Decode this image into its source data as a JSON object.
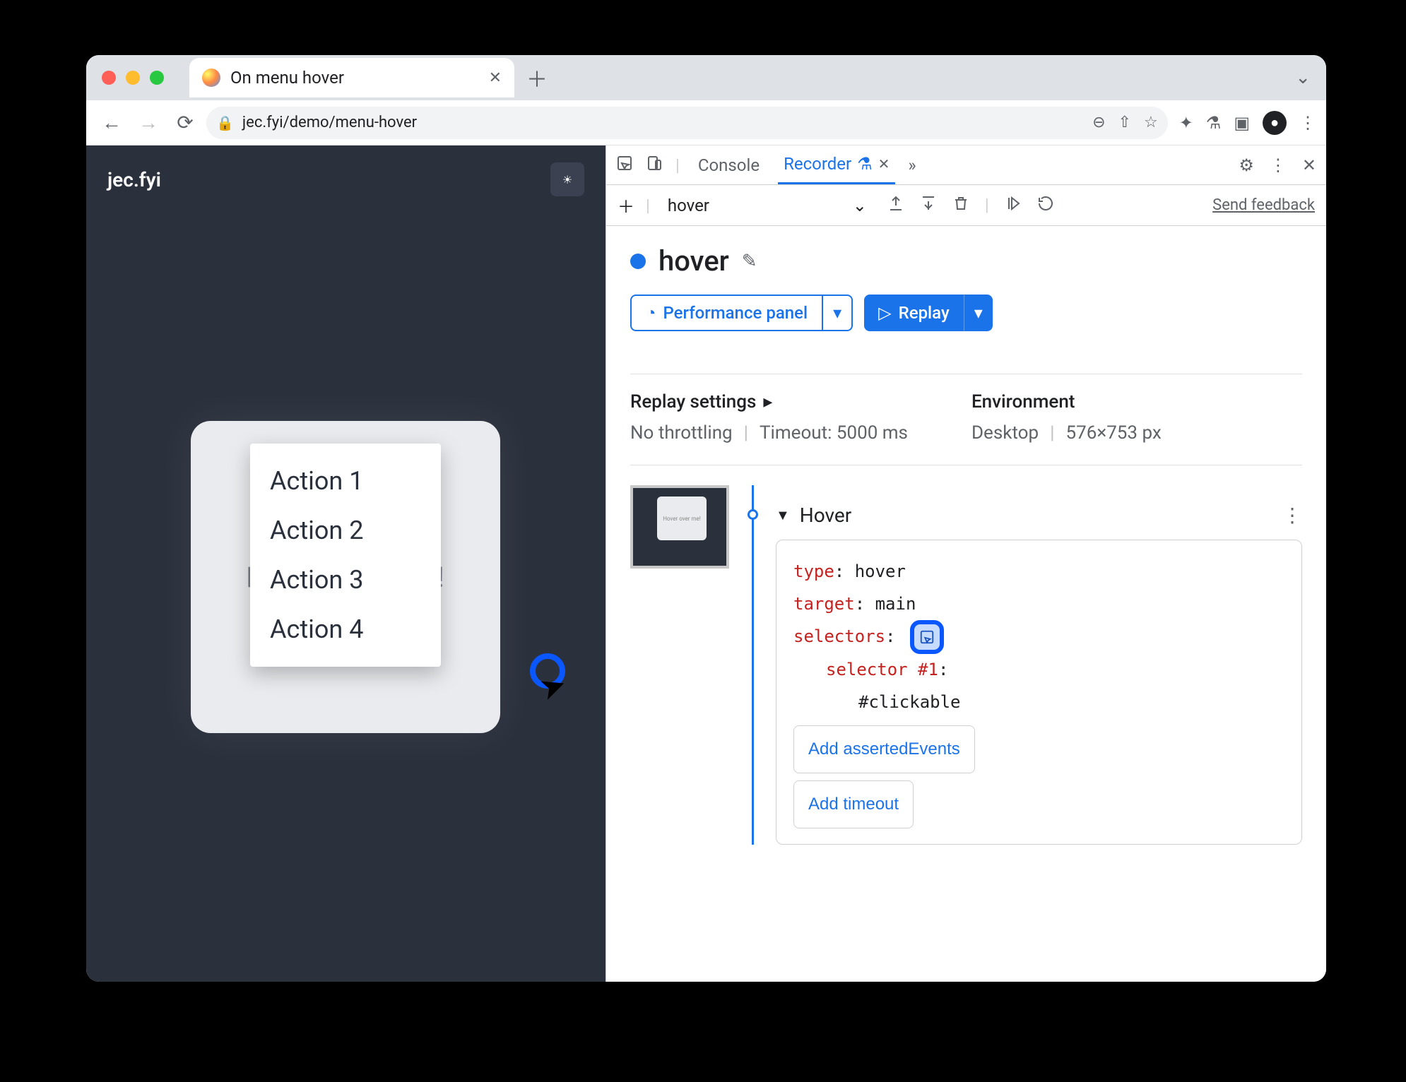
{
  "browser": {
    "tab_title": "On menu hover",
    "url": "jec.fyi/demo/menu-hover"
  },
  "page": {
    "site_name": "jec.fyi",
    "hover_card_text": "Hover over me!",
    "menu_items": [
      "Action 1",
      "Action 2",
      "Action 3",
      "Action 4"
    ]
  },
  "devtools": {
    "tabs": {
      "console": "Console",
      "recorder": "Recorder"
    },
    "recording_name": "hover",
    "recording_select": "hover",
    "perf_button": "Performance panel",
    "replay_button": "Replay",
    "feedback": "Send feedback",
    "replay_settings": {
      "heading": "Replay settings",
      "throttling": "No throttling",
      "timeout": "Timeout: 5000 ms"
    },
    "environment": {
      "heading": "Environment",
      "device": "Desktop",
      "viewport": "576×753 px"
    },
    "thumb_text": "Hover over me!",
    "step": {
      "name": "Hover",
      "type_key": "type",
      "type_val": "hover",
      "target_key": "target",
      "target_val": "main",
      "selectors_key": "selectors",
      "selector_label": "selector #1",
      "selector_val": "#clickable",
      "add_asserted": "Add assertedEvents",
      "add_timeout": "Add timeout"
    }
  }
}
